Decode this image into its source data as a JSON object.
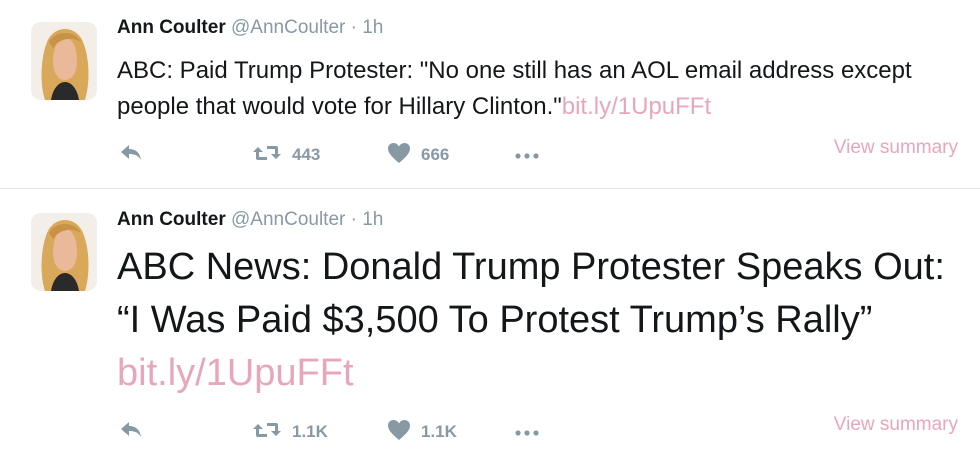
{
  "tweets": [
    {
      "author": "Ann Coulter",
      "handle": "@AnnCoulter",
      "separator": "·",
      "time": "1h",
      "text": "ABC: Paid Trump Protester: \"No one still has an AOL email address except people that would vote for Hillary Clinton.\"",
      "link": "bit.ly/1UpuFFt",
      "retweets": "443",
      "likes": "666",
      "view_summary": "View summary"
    },
    {
      "author": "Ann Coulter",
      "handle": "@AnnCoulter",
      "separator": "·",
      "time": "1h",
      "text": "ABC News: Donald Trump Protester Speaks Out: “I Was Paid $3,500 To Protest Trump’s Rally” ",
      "link": "bit.ly/1UpuFFt",
      "retweets": "1.1K",
      "likes": "1.1K",
      "view_summary": "View summary"
    }
  ],
  "icons": {
    "reply": "reply-icon",
    "retweet": "retweet-icon",
    "like": "heart-icon",
    "more": "more-icon"
  },
  "colors": {
    "text": "#14171a",
    "muted": "#8899a6",
    "link": "#e8a6bc",
    "divider": "#e1e8ed"
  }
}
